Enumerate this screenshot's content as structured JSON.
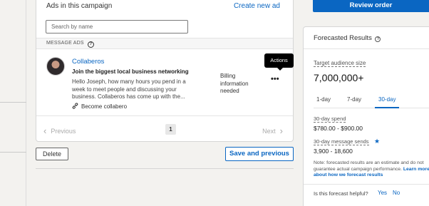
{
  "campaign": {
    "heading": "Ads in this campaign",
    "create_link": "Create new ad",
    "search_placeholder": "Search by name",
    "section_label": "MESSAGE ADS",
    "help_glyph": "?",
    "ad": {
      "name": "Collaberos",
      "headline": "Join the biggest local business networking",
      "body": "Hello Joseph, how many hours you pend in a week to meet people and discussing your business. Collaberos has come up with the...",
      "cta": "Become collabero",
      "status": "Billing information needed",
      "actions_tooltip": "Actions",
      "more_glyph": "•••"
    },
    "pager": {
      "prev": "Previous",
      "next": "Next",
      "current_page": "1",
      "prev_chevron": "‹",
      "next_chevron": "›"
    }
  },
  "footer": {
    "delete": "Delete",
    "save": "Save and previous"
  },
  "sidebar": {
    "review_order": "Review order",
    "forecast_title": "Forecasted Results",
    "help_glyph": "?",
    "target_label": "Target audience size",
    "target_value": "7,000,000+",
    "tabs": [
      "1-day",
      "7-day",
      "30-day"
    ],
    "active_tab": "30-day",
    "spend_label": "30-day spend",
    "spend_value": "$780.00 - $900.00",
    "sends_label": "30-day message sends",
    "sends_value": "3,900 - 18,600",
    "star_glyph": "★",
    "note_text": "Note: forecasted results are an estimate and do not guarantee actual campaign performance.",
    "note_link": "Learn more about how we forecast results",
    "helpful_q": "Is this forecast helpful?",
    "yes": "Yes",
    "no": "No"
  },
  "colors": {
    "accent": "#0a66c2",
    "background": "#f3f2ef",
    "tooltip_bg": "#000000"
  },
  "icons": [
    "help-icon",
    "link-icon",
    "more-icon",
    "star-icon",
    "chevron-left-icon",
    "chevron-right-icon"
  ]
}
